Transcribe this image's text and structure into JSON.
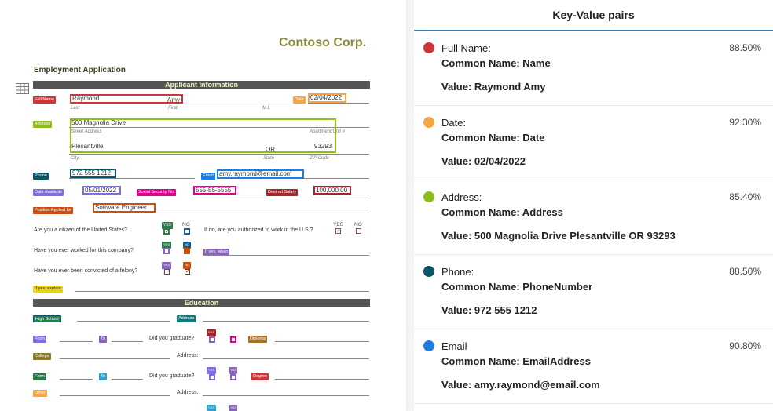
{
  "document": {
    "company": "Contoso Corp.",
    "form_title": "Employment Application",
    "sections": {
      "applicant": "Applicant Information",
      "education": "Education"
    },
    "sub_labels": {
      "last": "Last",
      "first": "First",
      "mi": "M.I.",
      "street": "Street Address",
      "apt": "Apartment/Unit #",
      "city": "City",
      "state": "State",
      "zip": "ZIP Code"
    },
    "fields": {
      "last_name": "Raymond",
      "first_name": "Amy",
      "date": "02/04/2022",
      "street": "500 Magnolia Drive",
      "city": "Plesantville",
      "state": "OR",
      "zip": "93293",
      "phone": "972 555 1212",
      "email": "amy.raymond@email.com",
      "date_available": "05/01/2022",
      "ssn": "555-55-5555",
      "salary": "100,000.00",
      "position": "Software Engineer"
    },
    "tags": {
      "full_name": "Full Name",
      "date": "Date",
      "address": "Address",
      "phone": "Phone",
      "email": "Email",
      "date_available": "Date Available",
      "ssn": "Social Security No.",
      "salary": "Desired Salary",
      "position": "Position Applied for",
      "yes": "YES",
      "no": "NO",
      "if_yes": "If yes, explain",
      "if_yes_when": "If yes, when",
      "high_school": "High School",
      "address2": "Address",
      "from": "From",
      "to": "To",
      "diploma": "Diploma",
      "college": "College",
      "degree": "Degree",
      "other": "Other"
    },
    "questions": {
      "citizen": "Are you a citizen of the United States?",
      "authorized": "If no, are you authorized to work in the U.S.?",
      "worked": "Have you ever worked for this company?",
      "felony": "Have you ever been convicted of a felony?",
      "graduate": "Did you graduate?",
      "address": "Address:"
    },
    "yes_label": "YES",
    "no_label": "NO",
    "check": "✓"
  },
  "panel": {
    "title": "Key-Value pairs",
    "common_prefix": "Common Name: ",
    "value_prefix": "Value: ",
    "items": [
      {
        "key": "Full Name:",
        "common": "Common Name: Name",
        "value": "Value: Raymond Amy",
        "confidence": "88.50%",
        "color": "#d13438"
      },
      {
        "key": "Date:",
        "common": "Common Name: Date",
        "value": "Value: 02/04/2022",
        "confidence": "92.30%",
        "color": "#f7a444"
      },
      {
        "key": "Address:",
        "common": "Common Name: Address",
        "value": "Value: 500 Magnolia Drive Plesantville OR 93293",
        "confidence": "85.40%",
        "color": "#8cbd18"
      },
      {
        "key": "Phone:",
        "common": "Common Name: PhoneNumber",
        "value": "Value: 972 555 1212",
        "confidence": "88.50%",
        "color": "#0b556a"
      },
      {
        "key": "Email",
        "common": "Common Name: EmailAddress",
        "value": "Value: amy.raymond@email.com",
        "confidence": "90.80%",
        "color": "#1c7fe0"
      }
    ]
  },
  "colors": {
    "full_name": "#d13438",
    "date": "#f7a444",
    "address": "#8cbd18",
    "phone": "#0b556a",
    "email": "#1c7fe0",
    "date_available": "#7d6ee3",
    "ssn": "#e3008c",
    "salary": "#a4262c",
    "position": "#ca5010",
    "yes_no": "#2c7a4a",
    "when": "#8764b8",
    "explain": "#e8d21d",
    "accent": "#3f7cae"
  },
  "icons": {
    "table": "table-icon"
  }
}
